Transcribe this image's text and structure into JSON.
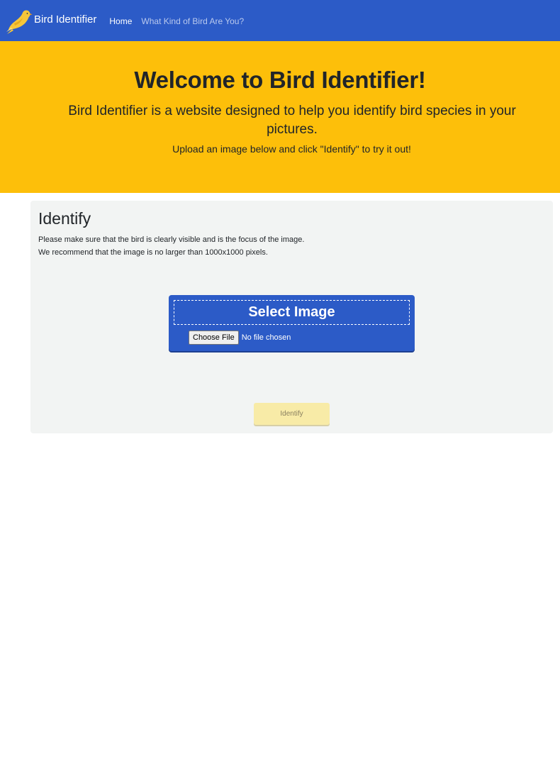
{
  "navbar": {
    "brand": "Bird Identifier",
    "links": [
      {
        "label": "Home",
        "active": true
      },
      {
        "label": "What Kind of Bird Are You?",
        "active": false
      }
    ]
  },
  "hero": {
    "title": "Welcome to Bird Identifier!",
    "lead": "Bird Identifier is a website designed to help you identify bird species in your pictures.",
    "instruction": "Upload an image below and click \"Identify\" to try it out!"
  },
  "identify_card": {
    "title": "Identify",
    "notes": [
      "Please make sure that the bird is clearly visible and is the focus of the image.",
      "We recommend that the image is no larger than 1000x1000 pixels."
    ],
    "upload": {
      "select_label": "Select Image",
      "choose_file_label": "Choose File",
      "file_status": "No file chosen"
    },
    "identify_button": "Identify"
  },
  "colors": {
    "navbar": "#2c5bc7",
    "hero": "#fdbf0a",
    "card": "#f2f4f3",
    "identify_button": "#f8eba7"
  },
  "icons": {
    "logo": "yellow-bird-icon"
  }
}
